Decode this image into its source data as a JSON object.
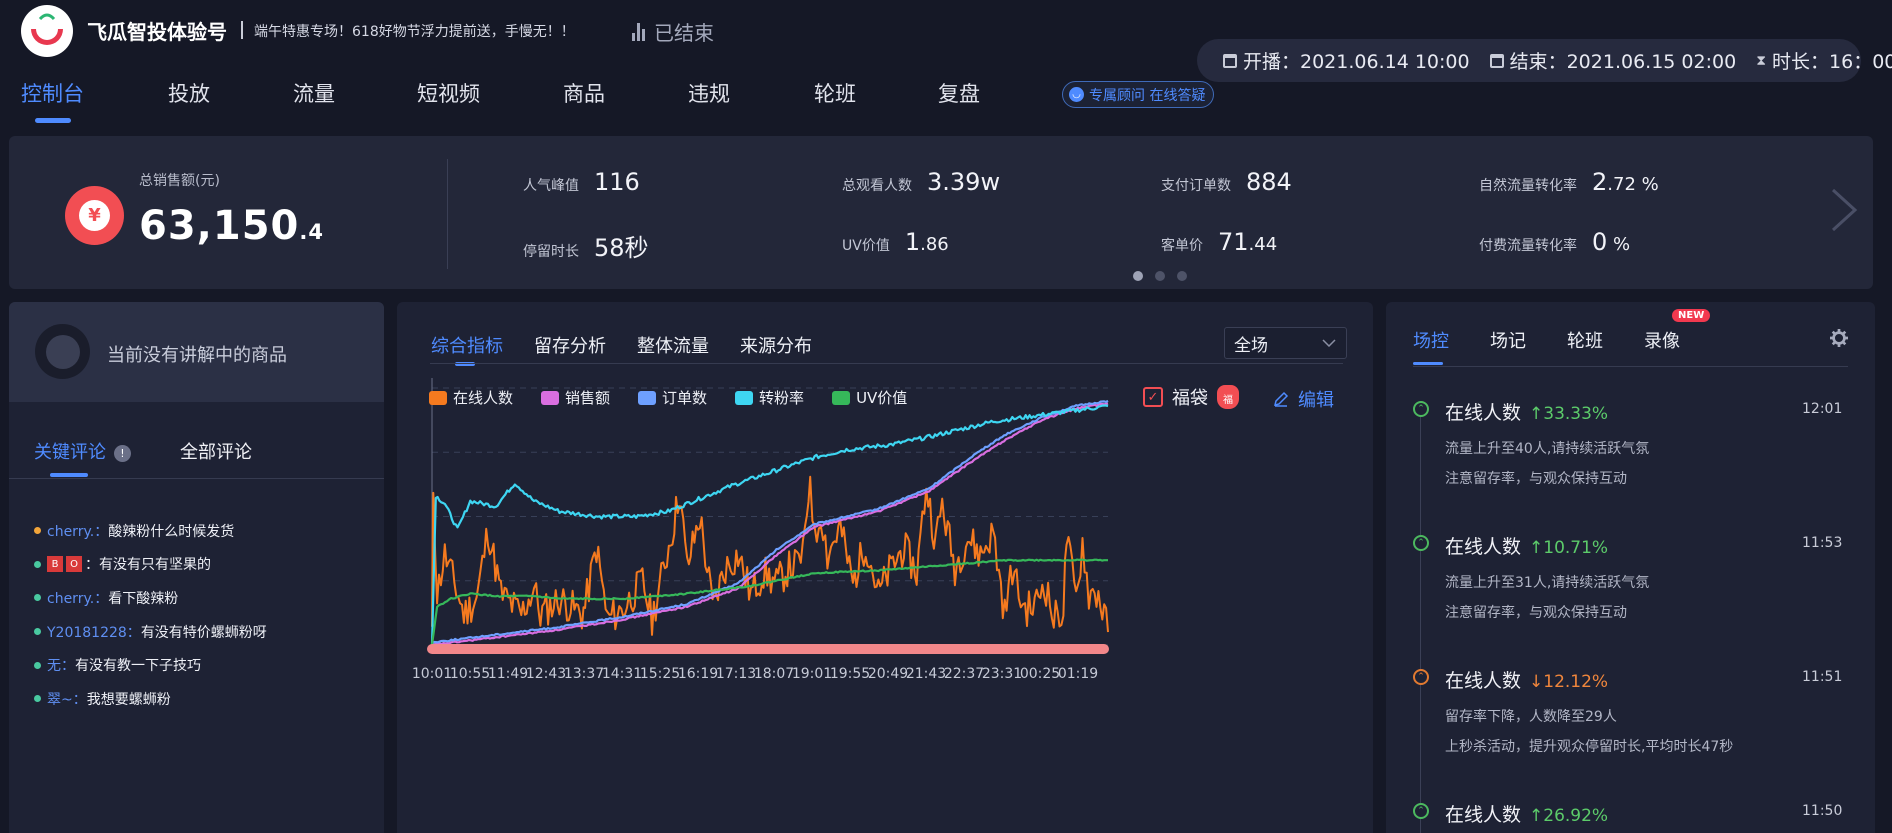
{
  "header": {
    "app_title": "飞瓜智投体验号",
    "slogan": "端午特惠专场！618好物节浮力提前送，手慢无！！",
    "status": "已结束",
    "start_label": "开播：2021.06.14 10:00",
    "end_label": "结束：2021.06.15 02:00",
    "duration_label": "时长：16：00",
    "nav": [
      "控制台",
      "投放",
      "流量",
      "短视频",
      "商品",
      "违规",
      "轮班",
      "复盘"
    ],
    "active_nav": "控制台",
    "consult": "专属顾问 在线答疑"
  },
  "kpi": {
    "sales_label": "总销售额(元)",
    "sales_int": "63,150",
    "sales_dec": ".4",
    "metrics": [
      {
        "label": "人气峰值",
        "value": "116",
        "small": ""
      },
      {
        "label": "总观看人数",
        "value": "3.39w",
        "small": ""
      },
      {
        "label": "支付订单数",
        "value": "884",
        "small": ""
      },
      {
        "label": "自然流量转化率",
        "value": "2",
        "small": ".72 %"
      },
      {
        "label": "停留时长",
        "value": "58秒",
        "small": ""
      },
      {
        "label": "UV价值",
        "value": "1",
        "small": ".86"
      },
      {
        "label": "客单价",
        "value": "71",
        "small": ".44"
      },
      {
        "label": "付费流量转化率",
        "value": "0",
        "small": " %"
      }
    ],
    "page_count": 3,
    "current_page": 1
  },
  "comments_panel": {
    "current_product": "当前没有讲解中的商品",
    "tabs": [
      "关键评论",
      "全部评论"
    ],
    "info_icon": "!",
    "items": [
      {
        "dot": "#f2a53a",
        "user": "cherry.：",
        "badges": [],
        "text": "酸辣粉什么时候发货"
      },
      {
        "dot": "#49c9a0",
        "user": "",
        "badges": [
          "B",
          "O"
        ],
        "text": "：有没有只有坚果的"
      },
      {
        "dot": "#49c9a0",
        "user": "cherry.：",
        "badges": [],
        "text": "看下酸辣粉"
      },
      {
        "dot": "#49c9a0",
        "user": "Y20181228：",
        "badges": [],
        "text": "有没有特价螺蛳粉呀"
      },
      {
        "dot": "#49c9a0",
        "user": "无：",
        "badges": [],
        "text": "有没有教一下子技巧"
      },
      {
        "dot": "#49c9a0",
        "user": "翠~：",
        "badges": [],
        "text": "我想要螺蛳粉"
      }
    ]
  },
  "center": {
    "tabs": [
      "综合指标",
      "留存分析",
      "整体流量",
      "来源分布"
    ],
    "scope": "全场",
    "lucky_bag": "福袋",
    "bag_glyph": "福",
    "edit": "编辑",
    "check_glyph": "✓"
  },
  "chart_data": {
    "type": "line",
    "title": "",
    "x_tick_labels": [
      "10:01",
      "10:55",
      "11:49",
      "12:43",
      "13:37",
      "14:31",
      "15:25",
      "16:19",
      "17:13",
      "18:07",
      "19:01",
      "19:55",
      "20:49",
      "21:43",
      "22:37",
      "23:31",
      "00:25",
      "01:19"
    ],
    "y_range": [
      0,
      100
    ],
    "y_axis_labels": "hidden",
    "grid": "horizontal dashed",
    "legend_position": "top-left",
    "series": [
      {
        "name": "在线人数",
        "color": "#f57a1f",
        "keypoints": [
          [
            0,
            5
          ],
          [
            2,
            62
          ],
          [
            8,
            20
          ],
          [
            20,
            35
          ],
          [
            38,
            22
          ],
          [
            50,
            12
          ],
          [
            70,
            18
          ],
          [
            88,
            45
          ],
          [
            108,
            20
          ],
          [
            140,
            12
          ],
          [
            160,
            22
          ],
          [
            170,
            12
          ],
          [
            200,
            18
          ],
          [
            235,
            12
          ],
          [
            240,
            15
          ],
          [
            258,
            38
          ],
          [
            275,
            10
          ],
          [
            300,
            14
          ],
          [
            330,
            25
          ],
          [
            345,
            10
          ],
          [
            380,
            48
          ],
          [
            388,
            60
          ],
          [
            400,
            30
          ],
          [
            420,
            50
          ],
          [
            440,
            15
          ],
          [
            460,
            30
          ],
          [
            480,
            35
          ],
          [
            500,
            20
          ],
          [
            520,
            28
          ],
          [
            540,
            24
          ],
          [
            560,
            30
          ],
          [
            575,
            32
          ],
          [
            585,
            40
          ],
          [
            593,
            68
          ],
          [
            600,
            40
          ],
          [
            610,
            52
          ],
          [
            620,
            35
          ],
          [
            640,
            46
          ],
          [
            660,
            24
          ],
          [
            680,
            40
          ],
          [
            700,
            20
          ],
          [
            720,
            30
          ],
          [
            740,
            38
          ],
          [
            760,
            28
          ],
          [
            775,
            62
          ],
          [
            790,
            40
          ],
          [
            800,
            55
          ],
          [
            820,
            30
          ],
          [
            840,
            42
          ],
          [
            860,
            35
          ],
          [
            880,
            44
          ],
          [
            898,
            12
          ],
          [
            910,
            30
          ],
          [
            920,
            20
          ],
          [
            930,
            14
          ],
          [
            945,
            15
          ],
          [
            960,
            25
          ],
          [
            975,
            10
          ],
          [
            990,
            14
          ],
          [
            995,
            42
          ],
          [
            1010,
            18
          ],
          [
            1020,
            40
          ],
          [
            1030,
            20
          ],
          [
            1045,
            20
          ],
          [
            1060,
            5
          ]
        ]
      },
      {
        "name": "销售额",
        "color": "#d96ee0",
        "keypoints": [
          [
            0,
            0
          ],
          [
            100,
            3
          ],
          [
            200,
            6
          ],
          [
            300,
            10
          ],
          [
            400,
            15
          ],
          [
            480,
            22
          ],
          [
            540,
            35
          ],
          [
            600,
            46
          ],
          [
            700,
            52
          ],
          [
            780,
            60
          ],
          [
            850,
            72
          ],
          [
            900,
            80
          ],
          [
            960,
            88
          ],
          [
            1010,
            92
          ],
          [
            1060,
            94
          ]
        ]
      },
      {
        "name": "订单数",
        "color": "#6ea0ff",
        "keypoints": [
          [
            0,
            1
          ],
          [
            100,
            4
          ],
          [
            200,
            7
          ],
          [
            300,
            11
          ],
          [
            400,
            16
          ],
          [
            480,
            24
          ],
          [
            540,
            37
          ],
          [
            600,
            47
          ],
          [
            700,
            53
          ],
          [
            780,
            61
          ],
          [
            850,
            74
          ],
          [
            900,
            82
          ],
          [
            960,
            89
          ],
          [
            1010,
            93
          ],
          [
            1060,
            95
          ]
        ]
      },
      {
        "name": "转粉率",
        "color": "#3ed6f2",
        "keypoints": [
          [
            0,
            0
          ],
          [
            6,
            58
          ],
          [
            20,
            55
          ],
          [
            40,
            45
          ],
          [
            60,
            56
          ],
          [
            100,
            54
          ],
          [
            130,
            63
          ],
          [
            160,
            56
          ],
          [
            200,
            52
          ],
          [
            260,
            50
          ],
          [
            320,
            50
          ],
          [
            370,
            52
          ],
          [
            430,
            58
          ],
          [
            470,
            62
          ],
          [
            540,
            68
          ],
          [
            600,
            73
          ],
          [
            650,
            76
          ],
          [
            720,
            78
          ],
          [
            780,
            81
          ],
          [
            830,
            84
          ],
          [
            880,
            87
          ],
          [
            940,
            89
          ],
          [
            1000,
            91
          ],
          [
            1060,
            93
          ]
        ]
      },
      {
        "name": "UV价值",
        "color": "#36b85a",
        "keypoints": [
          [
            0,
            0
          ],
          [
            8,
            15
          ],
          [
            30,
            18
          ],
          [
            60,
            20
          ],
          [
            100,
            19
          ],
          [
            160,
            19
          ],
          [
            200,
            18
          ],
          [
            300,
            18
          ],
          [
            400,
            20
          ],
          [
            500,
            23
          ],
          [
            600,
            28
          ],
          [
            700,
            29
          ],
          [
            800,
            31
          ],
          [
            900,
            33
          ],
          [
            960,
            33
          ],
          [
            1060,
            33
          ]
        ]
      }
    ]
  },
  "live_events": {
    "tabs": [
      "场控",
      "场记",
      "轮班",
      "录像"
    ],
    "new_badge": "NEW",
    "items": [
      {
        "title": "在线人数",
        "direction": "up",
        "change": "↑33.33%",
        "time": "12:01",
        "lines": [
          "流量上升至40人,请持续活跃气氛",
          "注意留存率，与观众保持互动"
        ]
      },
      {
        "title": "在线人数",
        "direction": "up",
        "change": "↑10.71%",
        "time": "11:53",
        "lines": [
          "流量上升至31人,请持续活跃气氛",
          "注意留存率，与观众保持互动"
        ]
      },
      {
        "title": "在线人数",
        "direction": "down",
        "change": "↓12.12%",
        "time": "11:51",
        "lines": [
          "留存率下降，人数降至29人",
          "上秒杀活动，提升观众停留时长,平均时长47秒"
        ]
      },
      {
        "title": "在线人数",
        "direction": "up",
        "change": "↑26.92%",
        "time": "11:50",
        "lines": []
      }
    ]
  }
}
